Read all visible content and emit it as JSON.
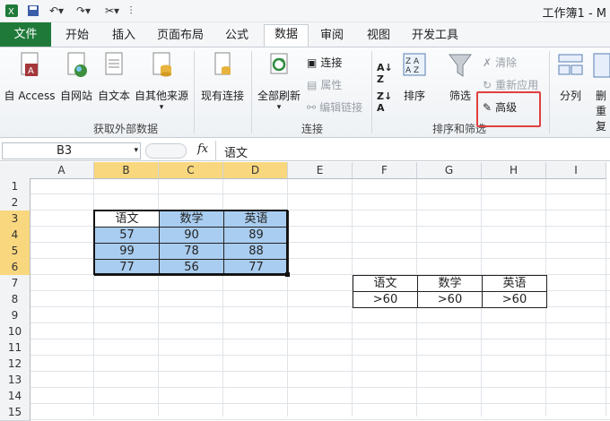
{
  "window": {
    "title": "工作簿1 - M"
  },
  "tabs": [
    {
      "label": "文件"
    },
    {
      "label": "开始"
    },
    {
      "label": "插入"
    },
    {
      "label": "页面布局"
    },
    {
      "label": "公式"
    },
    {
      "label": "数据"
    },
    {
      "label": "审阅"
    },
    {
      "label": "视图"
    },
    {
      "label": "开发工具"
    }
  ],
  "ribbon": {
    "external": {
      "access": "自 Access",
      "web": "自网站",
      "text": "自文本",
      "other": "自其他来源",
      "existing": "现有连接",
      "group": "获取外部数据"
    },
    "connections": {
      "refresh_all": "全部刷新",
      "connections": "连接",
      "properties": "属性",
      "edit_links": "编辑链接",
      "group": "连接"
    },
    "sort_filter": {
      "sort": "排序",
      "filter": "筛选",
      "clear": "清除",
      "reapply": "重新应用",
      "advanced": "高级",
      "group": "排序和筛选"
    },
    "tools": {
      "text_to_columns": "分列",
      "remove_dup_1": "删",
      "remove_dup_2": "重复"
    }
  },
  "formula_bar": {
    "name_box": "B3",
    "fx": "fx",
    "value": "语文"
  },
  "grid": {
    "columns": [
      "A",
      "B",
      "C",
      "D",
      "E",
      "F",
      "G",
      "H",
      "I"
    ],
    "rows": [
      "1",
      "2",
      "3",
      "4",
      "5",
      "6",
      "7",
      "8",
      "9",
      "10",
      "11",
      "12",
      "13",
      "14",
      "15"
    ],
    "table": {
      "header": [
        "语文",
        "数学",
        "英语"
      ],
      "rows": [
        [
          "57",
          "90",
          "89"
        ],
        [
          "99",
          "78",
          "88"
        ],
        [
          "77",
          "56",
          "77"
        ]
      ]
    },
    "criteria": {
      "header": [
        "语文",
        "数学",
        "英语"
      ],
      "row": [
        ">60",
        ">60",
        ">60"
      ]
    }
  },
  "colors": {
    "file_tab": "#1f7a3a",
    "selection_header": "#f9d77e",
    "table_fill": "#a9cdf0",
    "highlight": "#e0403f"
  }
}
